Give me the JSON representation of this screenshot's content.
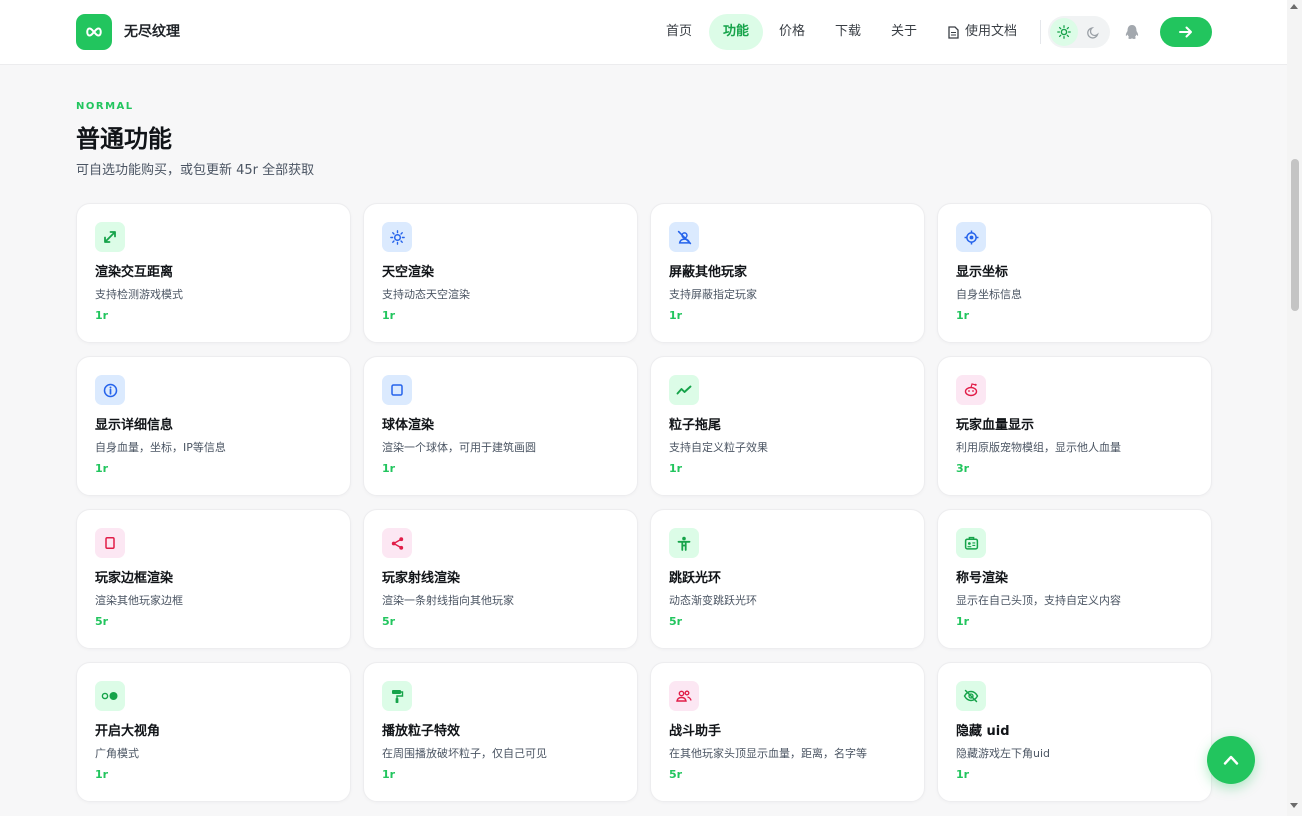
{
  "header": {
    "brand": "无尽纹理",
    "nav": [
      {
        "label": "首页",
        "active": false
      },
      {
        "label": "功能",
        "active": true
      },
      {
        "label": "价格",
        "active": false
      },
      {
        "label": "下载",
        "active": false
      },
      {
        "label": "关于",
        "active": false
      }
    ],
    "docs_label": "使用文档"
  },
  "section": {
    "eyebrow": "NORMAL",
    "title": "普通功能",
    "subtitle": "可自选功能购买，或包更新 45r 全部获取"
  },
  "cards": [
    {
      "title": "渲染交互距离",
      "desc": "支持检测游戏模式",
      "price": "1r",
      "icon": "expand-arrows-icon",
      "tone": "green"
    },
    {
      "title": "天空渲染",
      "desc": "支持动态天空渲染",
      "price": "1r",
      "icon": "sun-icon",
      "tone": "blue"
    },
    {
      "title": "屏蔽其他玩家",
      "desc": "支持屏蔽指定玩家",
      "price": "1r",
      "icon": "user-slash-icon",
      "tone": "blue"
    },
    {
      "title": "显示坐标",
      "desc": "自身坐标信息",
      "price": "1r",
      "icon": "crosshair-icon",
      "tone": "blue"
    },
    {
      "title": "显示详细信息",
      "desc": "自身血量，坐标，IP等信息",
      "price": "1r",
      "icon": "info-icon",
      "tone": "blue"
    },
    {
      "title": "球体渲染",
      "desc": "渲染一个球体，可用于建筑画圆",
      "price": "1r",
      "icon": "square-icon",
      "tone": "blue"
    },
    {
      "title": "粒子拖尾",
      "desc": "支持自定义粒子效果",
      "price": "1r",
      "icon": "trend-line-icon",
      "tone": "green"
    },
    {
      "title": "玩家血量显示",
      "desc": "利用原版宠物模组，显示他人血量",
      "price": "3r",
      "icon": "reddit-icon",
      "tone": "pink"
    },
    {
      "title": "玩家边框渲染",
      "desc": "渲染其他玩家边框",
      "price": "5r",
      "icon": "rectangle-icon",
      "tone": "pink"
    },
    {
      "title": "玩家射线渲染",
      "desc": "渲染一条射线指向其他玩家",
      "price": "5r",
      "icon": "share-nodes-icon",
      "tone": "pink"
    },
    {
      "title": "跳跃光环",
      "desc": "动态渐变跳跃光环",
      "price": "5r",
      "icon": "person-icon",
      "tone": "green"
    },
    {
      "title": "称号渲染",
      "desc": "显示在自己头顶，支持自定义内容",
      "price": "1r",
      "icon": "id-badge-icon",
      "tone": "green"
    },
    {
      "title": "开启大视角",
      "desc": "广角模式",
      "price": "1r",
      "icon": "toggle-icon",
      "tone": "green"
    },
    {
      "title": "播放粒子特效",
      "desc": "在周围播放破坏粒子，仅自己可见",
      "price": "1r",
      "icon": "paint-roller-icon",
      "tone": "green"
    },
    {
      "title": "战斗助手",
      "desc": "在其他玩家头顶显示血量，距离，名字等",
      "price": "5r",
      "icon": "users-icon",
      "tone": "pink"
    },
    {
      "title": "隐藏 uid",
      "desc": "隐藏游戏左下角uid",
      "price": "1r",
      "icon": "eye-slash-icon",
      "tone": "green"
    }
  ]
}
